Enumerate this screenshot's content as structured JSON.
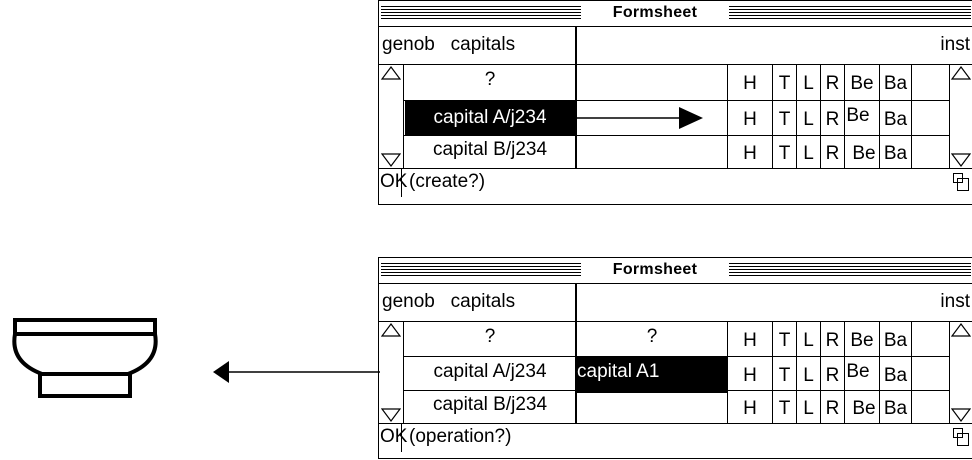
{
  "windows": [
    {
      "title": "Formsheet",
      "header": {
        "left": "genob   capitals",
        "right": "inst"
      },
      "columns": [
        "H",
        "T",
        "L",
        "R",
        "Be",
        "Ba"
      ],
      "rows": [
        {
          "name": "?",
          "value": ""
        },
        {
          "name": "capital A/j234",
          "value": ""
        },
        {
          "name": "capital B/j234",
          "value": ""
        }
      ],
      "footer": {
        "ok": "OK",
        "status": "(create?)"
      }
    },
    {
      "title": "Formsheet",
      "header": {
        "left": "genob   capitals",
        "right": "inst"
      },
      "columns": [
        "H",
        "T",
        "L",
        "R",
        "Be",
        "Ba"
      ],
      "rows": [
        {
          "name": "?",
          "value": "?"
        },
        {
          "name": "capital A/j234",
          "value": "capital A1"
        },
        {
          "name": "capital B/j234",
          "value": ""
        }
      ],
      "footer": {
        "ok": "OK",
        "status": "(operation?)"
      }
    }
  ],
  "icons": [
    "capital-icon",
    "arrow-left-icon",
    "arrow-right-icon",
    "scroll-up-icon",
    "scroll-down-icon",
    "grow-box-icon"
  ]
}
